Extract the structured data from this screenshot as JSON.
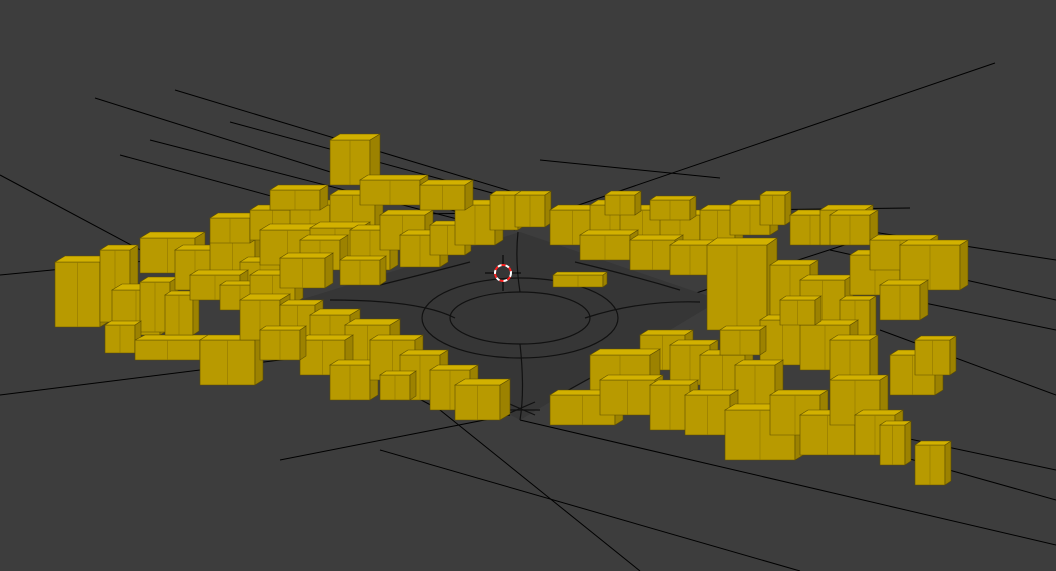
{
  "viewport": {
    "background_color": "#3d3d3d",
    "building_color": "#c9a900",
    "building_shade_left": "#b89a00",
    "building_shade_right": "#9c8200",
    "grid_color": "#000000",
    "ground_color": "#363636"
  },
  "cursor": {
    "icon": "3d-cursor-icon",
    "ring_color_a": "#ff2020",
    "ring_color_b": "#ffffff"
  }
}
